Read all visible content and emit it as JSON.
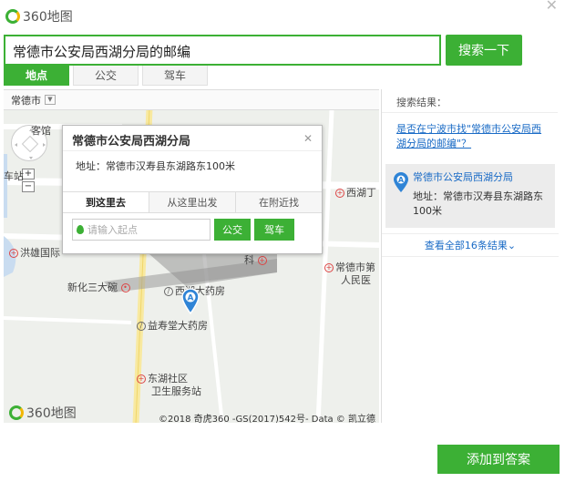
{
  "header": {
    "logo_text": "360地图"
  },
  "search": {
    "value": "常德市公安局西湖分局的邮编",
    "button_label": "搜索一下"
  },
  "tabs": [
    {
      "label": "地点",
      "active": true
    },
    {
      "label": "公交",
      "active": false
    },
    {
      "label": "驾车",
      "active": false
    }
  ],
  "map": {
    "city": "常德市",
    "labels": {
      "l1": "客馆",
      "l2": "车站",
      "l3": "西湖丁",
      "l4": "洪雄国际",
      "l5": "常德市第",
      "l6": "人民医",
      "l7": "新化三大碗",
      "l8": "西湖大药房",
      "l9": "益寿堂大药房",
      "l10": "东湖社区",
      "l11": "卫生服务站",
      "l12": "科"
    },
    "logo_text": "360地图",
    "copyright": "©2018 奇虎360 -GS(2017)542号- Data © 凯立德"
  },
  "popup": {
    "title": "常德市公安局西湖分局",
    "address": "地址：常德市汉寿县东湖路东100米",
    "tabs": [
      "到这里去",
      "从这里出发",
      "在附近找"
    ],
    "input_placeholder": "请输入起点",
    "bus_label": "公交",
    "car_label": "驾车"
  },
  "results": {
    "header": "搜索结果：",
    "suggest": "是否在宁波市找\"常德市公安局西湖分局的邮编\"？",
    "item": {
      "name": "常德市公安局西湖分局",
      "address": "地址：常德市汉寿县东湖路东100米",
      "marker": "A"
    },
    "more": "查看全部16条结果"
  },
  "footer": {
    "add_button": "添加到答案"
  },
  "colors": {
    "accent": "#3cb035",
    "link": "#1a6bc6"
  }
}
